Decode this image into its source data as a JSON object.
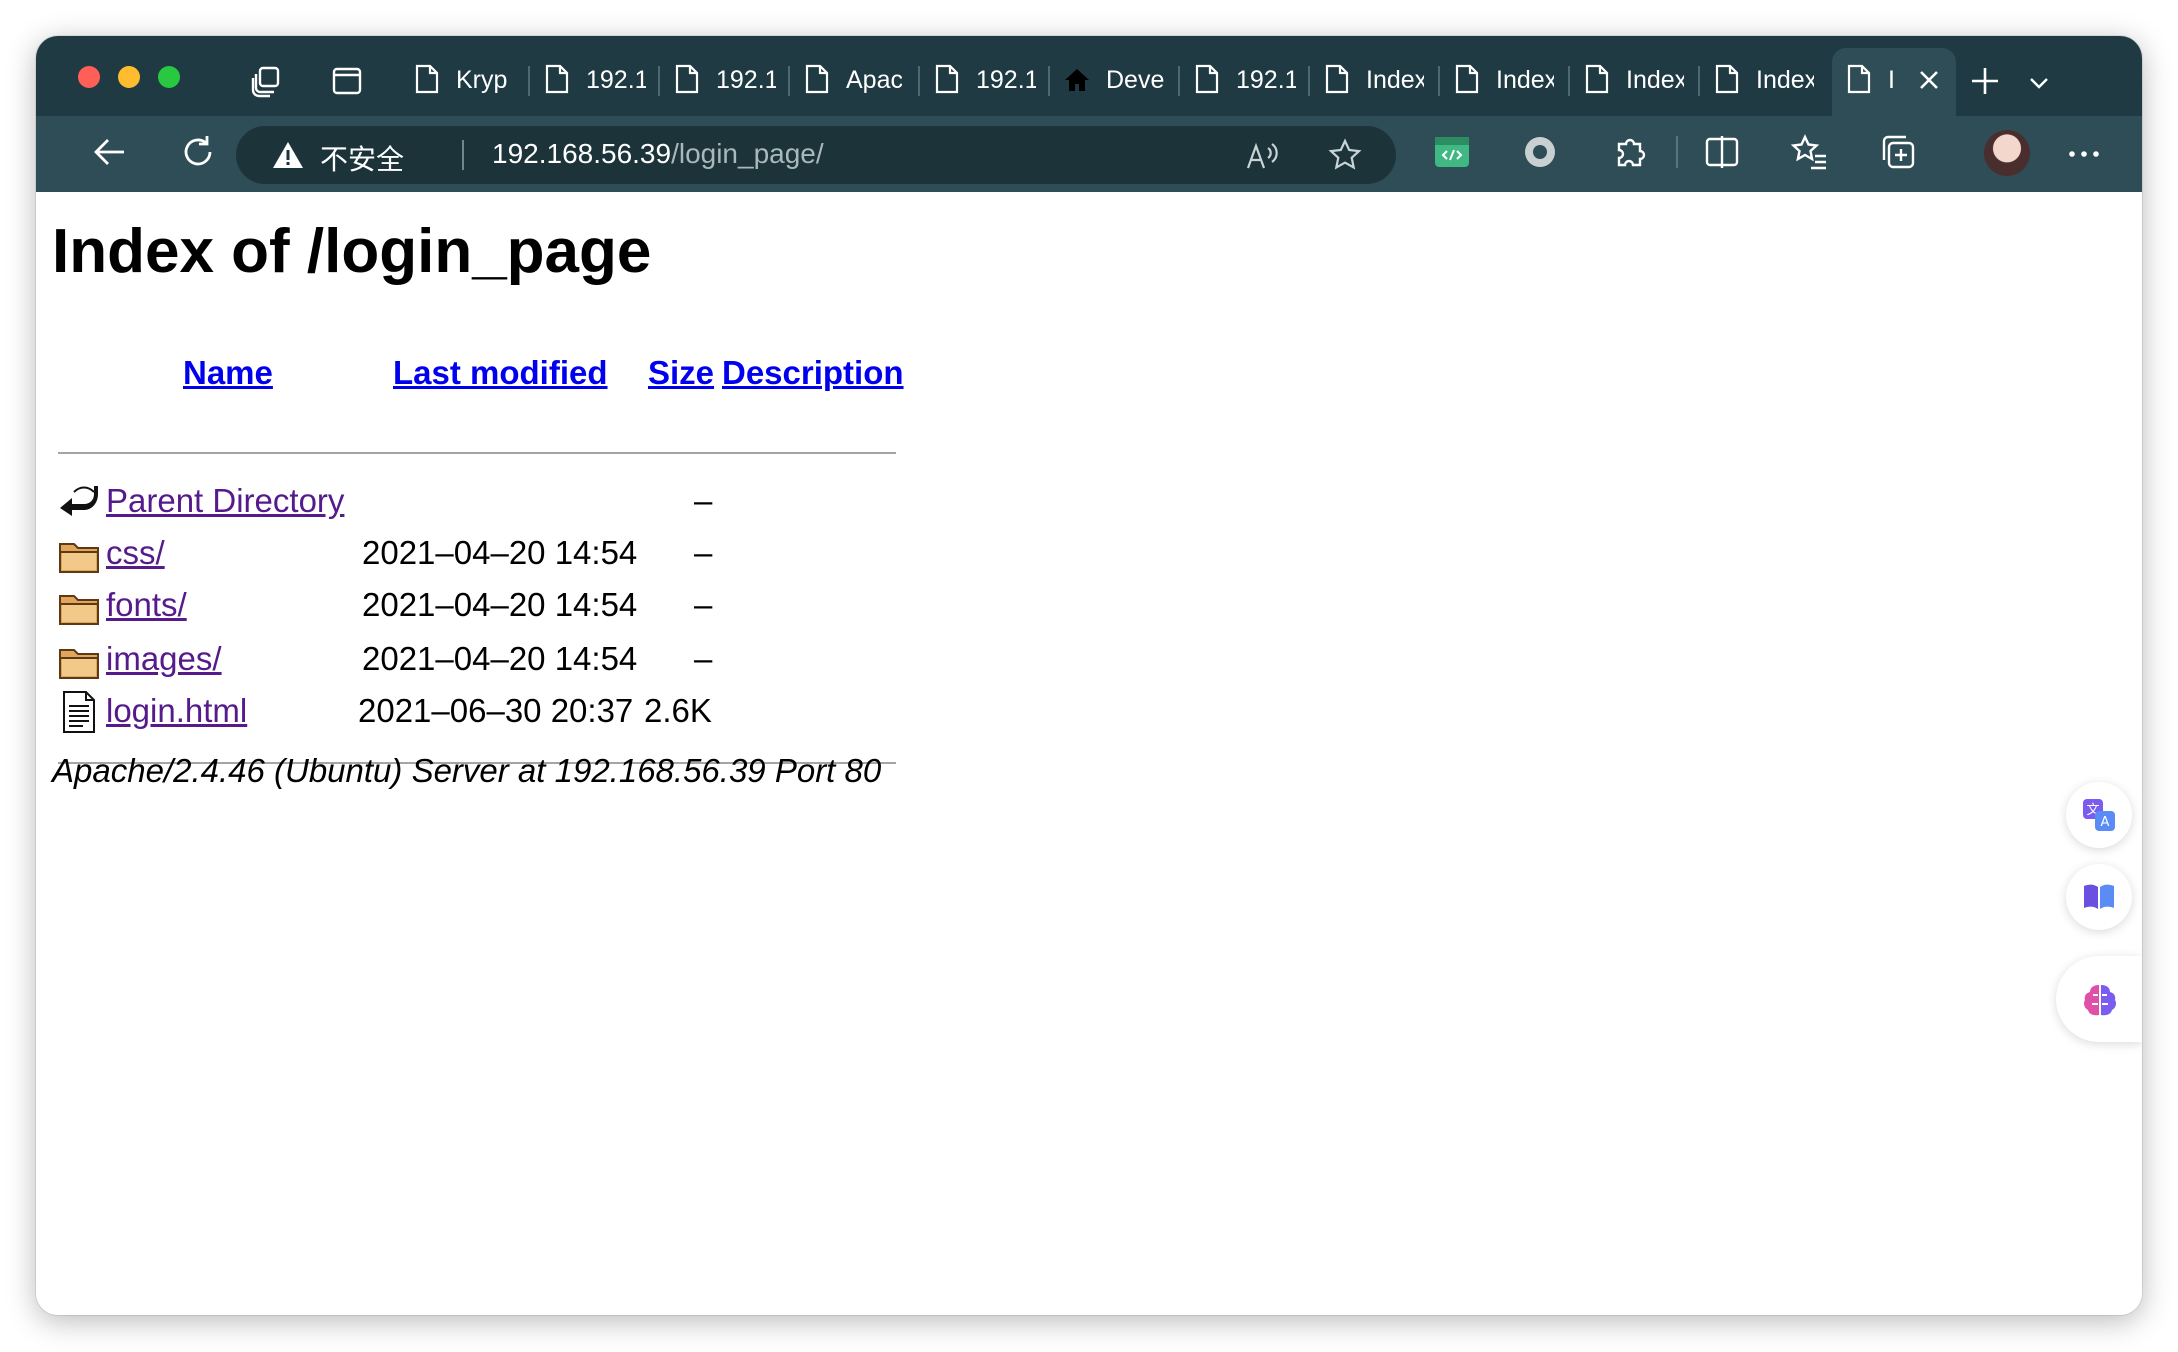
{
  "browser": {
    "tabs": [
      {
        "label": "Kryp"
      },
      {
        "label": "192.1"
      },
      {
        "label": "192.1"
      },
      {
        "label": "Apac"
      },
      {
        "label": "192.1"
      },
      {
        "label": "Deve"
      },
      {
        "label": "192.1"
      },
      {
        "label": "Index"
      },
      {
        "label": "Index"
      },
      {
        "label": "Index"
      },
      {
        "label": "Index"
      },
      {
        "label": "I"
      }
    ],
    "address": {
      "security_label": "不安全",
      "host": "192.168.56.39",
      "path": "/login_page/"
    },
    "icons": {
      "window_controls": [
        "close",
        "minimize",
        "zoom"
      ],
      "tab_actions": [
        "collections-icon",
        "vertical-tabs-icon"
      ],
      "toolbar": [
        "back-arrow-icon",
        "refresh-icon",
        "read-aloud-icon",
        "favorite-star-icon",
        "devtools-extension-icon",
        "record-extension-icon",
        "extensions-puzzle-icon",
        "split-screen-icon",
        "favorites-list-icon",
        "collections-add-icon",
        "profile-avatar",
        "more-dots-icon"
      ]
    }
  },
  "page": {
    "title": "Index of /login_page",
    "columns": {
      "name": "Name",
      "last_modified": "Last modified",
      "size": "Size",
      "description": "Description"
    },
    "entries": [
      {
        "icon": "back-arrow-icon",
        "name": "Parent Directory",
        "modified": "",
        "size": "–"
      },
      {
        "icon": "folder-icon",
        "name": "css/",
        "modified": "2021–04–20 14:54",
        "size": "–"
      },
      {
        "icon": "folder-icon",
        "name": "fonts/",
        "modified": "2021–04–20 14:54",
        "size": "–"
      },
      {
        "icon": "folder-icon",
        "name": "images/",
        "modified": "2021–04–20 14:54",
        "size": "–"
      },
      {
        "icon": "text-file-icon",
        "name": "login.html",
        "modified": "2021–06–30 20:37",
        "size": "2.6K"
      }
    ],
    "server_signature": "Apache/2.4.46 (Ubuntu) Server at 192.168.56.39 Port 80"
  },
  "side_panel": {
    "buttons": [
      "translate-icon",
      "reader-book-icon",
      "ai-brain-icon"
    ]
  },
  "colors": {
    "tabbar": "#1f3a42",
    "toolbar": "#2e4d56",
    "link_unvisited": "#0000ee",
    "link_visited": "#551a8b"
  }
}
